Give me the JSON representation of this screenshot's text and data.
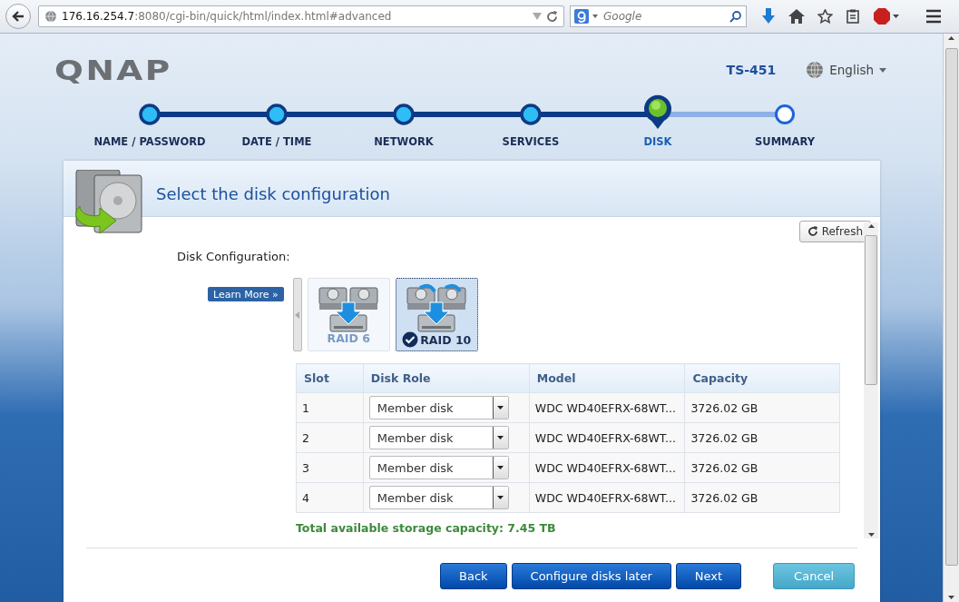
{
  "browser": {
    "url": "**176.16.254.7**:8080/cgi-bin/quick/html/index.html#advanced",
    "search_placeholder": "Google"
  },
  "header": {
    "logo": "QNAP",
    "model": "TS-451",
    "language": "English"
  },
  "steps": [
    {
      "label": "NAME / PASSWORD",
      "completed": true,
      "selected": false
    },
    {
      "label": "DATE / TIME",
      "completed": true,
      "selected": false
    },
    {
      "label": "NETWORK",
      "completed": true,
      "selected": false
    },
    {
      "label": "SERVICES",
      "completed": true,
      "selected": false
    },
    {
      "label": "DISK",
      "completed": false,
      "selected": true
    },
    {
      "label": "SUMMARY",
      "completed": false,
      "selected": false
    }
  ],
  "panel": {
    "title": "Select the disk configuration",
    "refresh": "Refresh",
    "config_label": "Disk Configuration:",
    "learn_more": "Learn More »",
    "raid_options": [
      {
        "label": "RAID 6",
        "selected": false
      },
      {
        "label": "RAID 10",
        "selected": true
      }
    ],
    "table": {
      "columns": [
        "Slot",
        "Disk Role",
        "Model",
        "Capacity"
      ],
      "rows": [
        {
          "slot": "1",
          "role": "Member disk",
          "model": "WDC WD40EFRX-68WT...",
          "capacity": "3726.02 GB"
        },
        {
          "slot": "2",
          "role": "Member disk",
          "model": "WDC WD40EFRX-68WT...",
          "capacity": "3726.02 GB"
        },
        {
          "slot": "3",
          "role": "Member disk",
          "model": "WDC WD40EFRX-68WT...",
          "capacity": "3726.02 GB"
        },
        {
          "slot": "4",
          "role": "Member disk",
          "model": "WDC WD40EFRX-68WT...",
          "capacity": "3726.02 GB"
        }
      ]
    },
    "total": "Total available storage capacity: 7.45 TB"
  },
  "buttons": [
    {
      "label": "Back",
      "kind": "primary"
    },
    {
      "label": "Configure disks later",
      "kind": "primary"
    },
    {
      "label": "Next",
      "kind": "primary"
    },
    {
      "label": "Cancel",
      "kind": "secondary"
    }
  ]
}
